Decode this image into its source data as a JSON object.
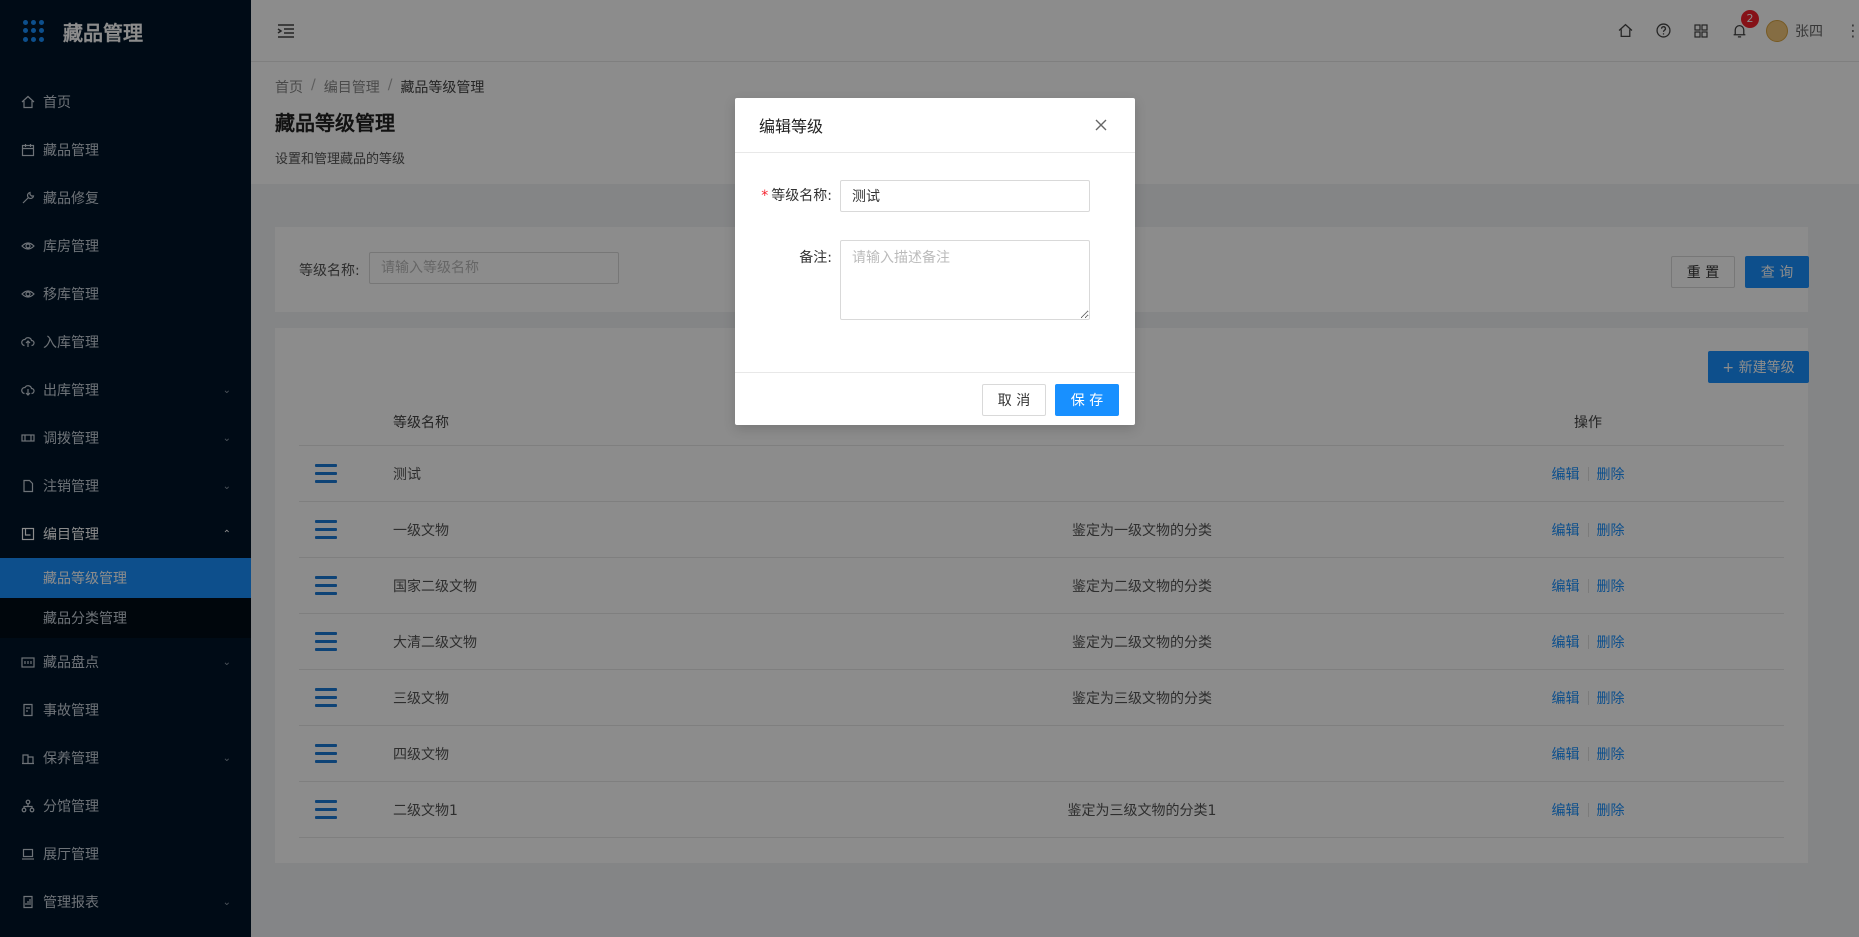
{
  "app": {
    "title": "藏品管理"
  },
  "sidebar": {
    "items": [
      {
        "label": "首页",
        "icon": "home-icon"
      },
      {
        "label": "藏品管理",
        "icon": "calendar-icon"
      },
      {
        "label": "藏品修复",
        "icon": "wrench-icon"
      },
      {
        "label": "库房管理",
        "icon": "eye-icon"
      },
      {
        "label": "移库管理",
        "icon": "eye-icon"
      },
      {
        "label": "入库管理",
        "icon": "cloud-upload-icon"
      },
      {
        "label": "出库管理",
        "icon": "cloud-download-icon",
        "expandable": true
      },
      {
        "label": "调拨管理",
        "icon": "transfer-icon",
        "expandable": true
      },
      {
        "label": "注销管理",
        "icon": "file-icon",
        "expandable": true
      },
      {
        "label": "编目管理",
        "icon": "catalog-icon",
        "expandable": true,
        "open": true
      }
    ],
    "sub_items": [
      {
        "label": "藏品等级管理",
        "active": true
      },
      {
        "label": "藏品分类管理",
        "active": false
      }
    ],
    "items_after": [
      {
        "label": "藏品盘点",
        "icon": "inventory-icon",
        "expandable": true
      },
      {
        "label": "事故管理",
        "icon": "report-icon"
      },
      {
        "label": "保养管理",
        "icon": "building-icon",
        "expandable": true
      },
      {
        "label": "分馆管理",
        "icon": "cluster-icon"
      },
      {
        "label": "展厅管理",
        "icon": "laptop-icon"
      },
      {
        "label": "管理报表",
        "icon": "chart-report-icon",
        "expandable": true
      }
    ]
  },
  "header": {
    "notifications_count": "2",
    "username": "张四"
  },
  "breadcrumb": [
    "首页",
    "编目管理",
    "藏品等级管理"
  ],
  "page": {
    "title": "藏品等级管理",
    "description": "设置和管理藏品的等级"
  },
  "search": {
    "label": "等级名称:",
    "placeholder": "请输入等级名称",
    "reset_label": "重 置",
    "query_label": "查 询"
  },
  "toolbar": {
    "new_label": "+ 新建等级"
  },
  "table": {
    "columns": [
      "等级名称",
      "操作"
    ],
    "rows": [
      {
        "name": "测试",
        "remark": ""
      },
      {
        "name": "一级文物",
        "remark": "鉴定为一级文物的分类"
      },
      {
        "name": "国家二级文物",
        "remark": "鉴定为二级文物的分类"
      },
      {
        "name": "大清二级文物",
        "remark": "鉴定为二级文物的分类"
      },
      {
        "name": "三级文物",
        "remark": "鉴定为三级文物的分类"
      },
      {
        "name": "四级文物",
        "remark": ""
      },
      {
        "name": "二级文物1",
        "remark": "鉴定为三级文物的分类1"
      }
    ],
    "edit_label": "编辑",
    "delete_label": "删除"
  },
  "modal": {
    "title": "编辑等级",
    "name_label": "等级名称:",
    "name_value": "测试",
    "remark_label": "备注:",
    "remark_placeholder": "请输入描述备注",
    "cancel_label": "取 消",
    "save_label": "保 存"
  },
  "colors": {
    "primary": "#1890ff",
    "sidebar_bg": "#001529",
    "danger": "#f5222d"
  }
}
